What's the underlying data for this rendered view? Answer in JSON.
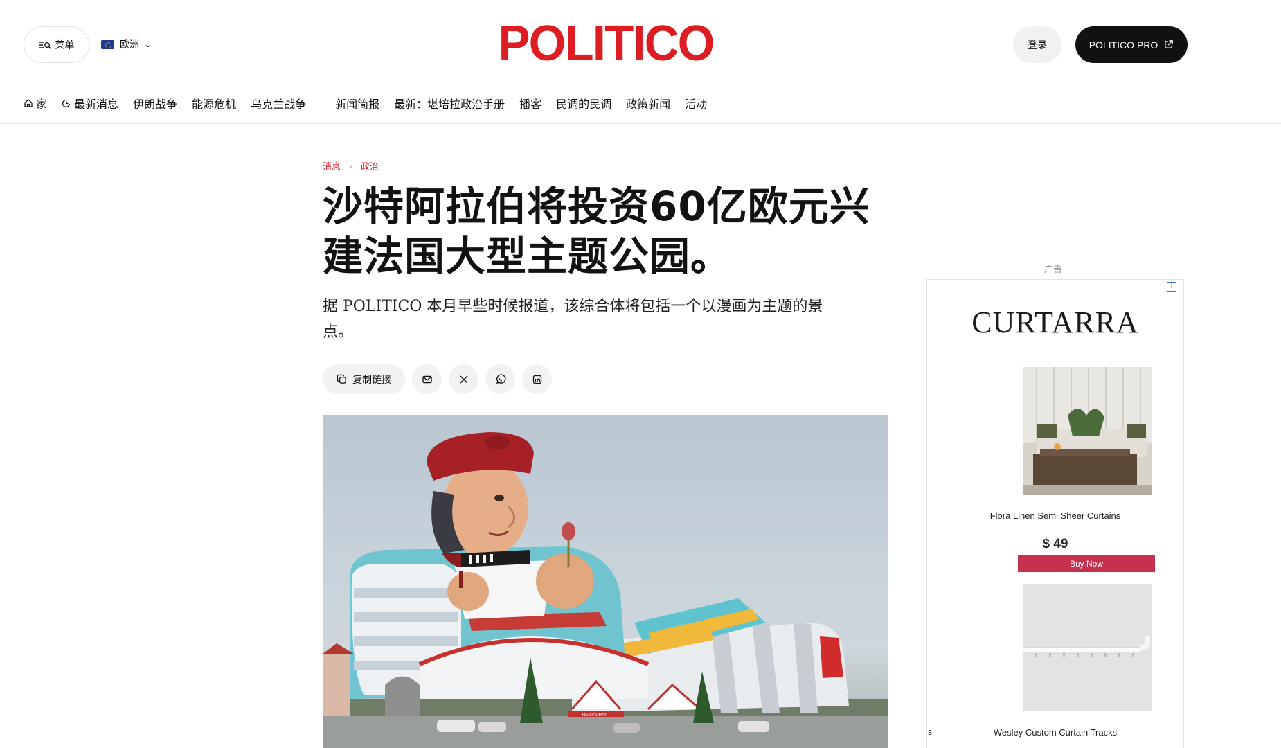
{
  "header": {
    "menu_label": "菜单",
    "region_label": "欧洲",
    "logo_text": "POLITICO",
    "login_label": "登录",
    "pro_label": "POLITICO PRO"
  },
  "nav": {
    "items": [
      "家",
      "最新消息",
      "伊朗战争",
      "能源危机",
      "乌克兰战争",
      "新闻简报",
      "最新：堪培拉政治手册",
      "播客",
      "民调的民调",
      "政策新闻",
      "活动"
    ]
  },
  "article": {
    "breadcrumb": [
      "消息",
      "政治"
    ],
    "headline_line1": "沙特阿拉伯将投资60亿欧元兴",
    "headline_line2": "建法国大型主题公园。",
    "dek_line1": "据 POLITICO 本月早些时候报道，该综合体将包括一个以漫画为主题的景",
    "dek_line2": "点。",
    "copy_link_label": "复制链接",
    "hero_sign_text": "RESTAURANT"
  },
  "ad": {
    "label": "广告",
    "info_icon": "i",
    "brand": "CURTARRA",
    "products": [
      {
        "name": "Flora Linen Semi Sheer Curtains",
        "price": "$ 49",
        "cta": "Buy Now"
      },
      {
        "name": "Wesley Custom Curtain Tracks"
      }
    ],
    "stray_text": "s"
  },
  "colors": {
    "brand_red": "#dc1e24",
    "ad_button": "#c4304e",
    "pro_button": "#111111"
  }
}
